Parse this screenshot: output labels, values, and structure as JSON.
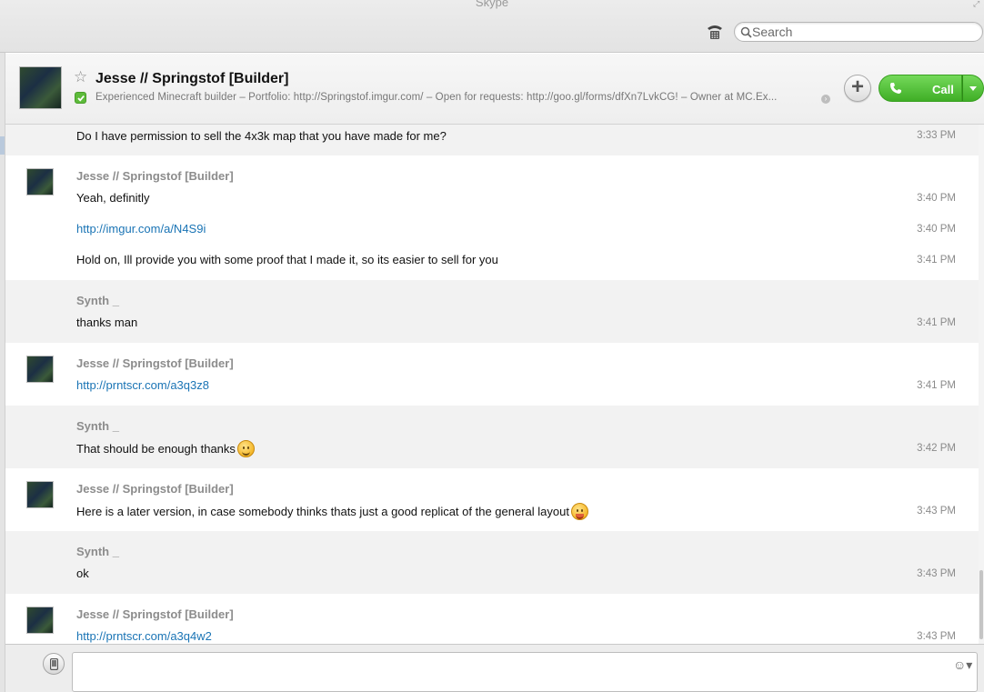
{
  "window": {
    "title": "Skype"
  },
  "toolbar": {
    "search_placeholder": "Search"
  },
  "contact": {
    "name": "Jesse // Springstof [Builder]",
    "mood": "Experienced Minecraft builder – Portfolio: http://Springstof.imgur.com/ – Open for requests: http://goo.gl/forms/dfXn7LvkCG! – Owner at MC.Ex...",
    "status": "online",
    "call_label": "Call"
  },
  "colors": {
    "link": "#1a74b5",
    "call_green": "#3fae26",
    "status_green": "#5dbb3a"
  },
  "messages": [
    {
      "sender": "",
      "show_avatar": false,
      "lines": [
        {
          "text": "Do I have permission to sell the 4x3k map that you have made for me?",
          "time": "3:33 PM",
          "link": false
        }
      ]
    },
    {
      "sender": "Jesse // Springstof [Builder]",
      "show_avatar": true,
      "lines": [
        {
          "text": "Yeah, definitly",
          "time": "3:40 PM",
          "link": false
        },
        {
          "text": "http://imgur.com/a/N4S9i",
          "time": "3:40 PM",
          "link": true
        },
        {
          "text": "Hold on, Ill provide you with some proof that I made it, so its easier to sell for you",
          "time": "3:41 PM",
          "link": false
        }
      ]
    },
    {
      "sender": "Synth _",
      "show_avatar": false,
      "lines": [
        {
          "text": "thanks man",
          "time": "3:41 PM",
          "link": false
        }
      ]
    },
    {
      "sender": "Jesse // Springstof [Builder]",
      "show_avatar": true,
      "lines": [
        {
          "text": "http://prntscr.com/a3q3z8",
          "time": "3:41 PM",
          "link": true
        }
      ]
    },
    {
      "sender": "Synth _",
      "show_avatar": false,
      "lines": [
        {
          "text": "That should be enough thanks",
          "time": "3:42 PM",
          "link": false,
          "emoji": "smile-emoji"
        }
      ]
    },
    {
      "sender": "Jesse // Springstof [Builder]",
      "show_avatar": true,
      "lines": [
        {
          "text": "Here is a later version, in case somebody thinks thats just a good replicat of the general layout",
          "time": "3:43 PM",
          "link": false,
          "emoji": "tongue-emoji"
        }
      ]
    },
    {
      "sender": "Synth _",
      "show_avatar": false,
      "lines": [
        {
          "text": "ok",
          "time": "3:43 PM",
          "link": false
        }
      ]
    },
    {
      "sender": "Jesse // Springstof [Builder]",
      "show_avatar": true,
      "lines": [
        {
          "text": "http://prntscr.com/a3q4w2",
          "time": "3:43 PM",
          "link": true
        }
      ]
    }
  ],
  "compose": {
    "placeholder": ""
  }
}
